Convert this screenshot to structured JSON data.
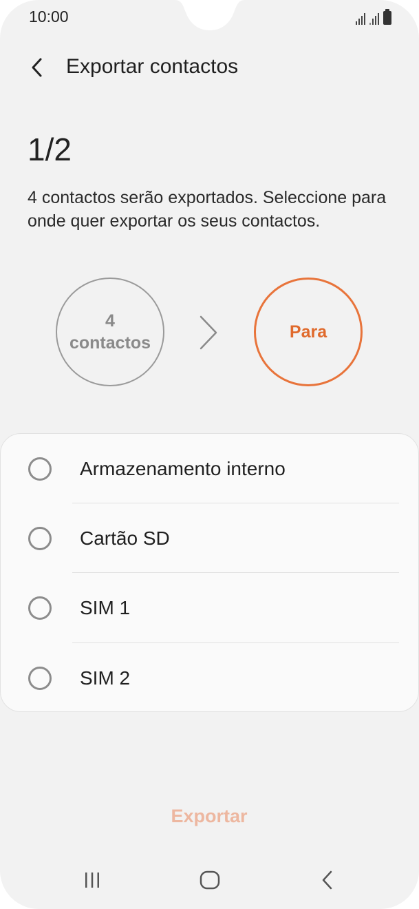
{
  "status_bar": {
    "time": "10:00",
    "icons": [
      "signal-icon",
      "signal-icon",
      "battery-icon"
    ]
  },
  "header": {
    "back_icon": "chevron-left-icon",
    "title": "Exportar contactos"
  },
  "step": "1/2",
  "description": "4 contactos serão exportados. Seleccione para onde quer exportar os seus contactos.",
  "flow": {
    "source_count": "4",
    "source_unit": "contactos",
    "arrow_icon": "chevron-right-icon",
    "target_label": "Para"
  },
  "options": [
    {
      "label": "Armazenamento interno",
      "selected": false
    },
    {
      "label": "Cartão SD",
      "selected": false
    },
    {
      "label": "SIM 1",
      "selected": false
    },
    {
      "label": "SIM 2",
      "selected": false
    }
  ],
  "export_label": "Exportar",
  "nav": {
    "recents_icon": "recents-icon",
    "home_icon": "home-icon",
    "back_icon": "back-icon"
  },
  "colors": {
    "accent": "#e8743b",
    "accent_disabled": "#edb7a0",
    "background": "#f2f2f2",
    "card": "#fafafa"
  }
}
